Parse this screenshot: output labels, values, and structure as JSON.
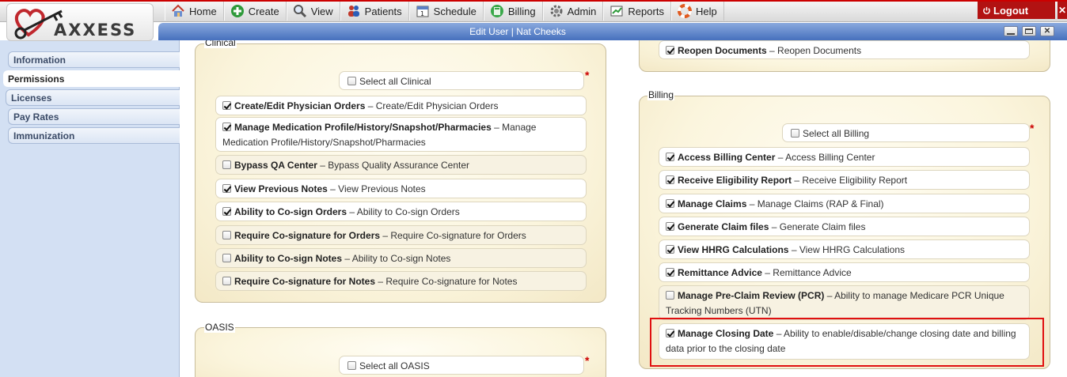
{
  "app": {
    "brand": "AXXESS",
    "window_title": "Edit User | Nat Cheeks",
    "logout_label": "Logout",
    "close_glyph": "✕"
  },
  "nav": [
    {
      "label": "Home",
      "icon": "house-icon"
    },
    {
      "label": "Create",
      "icon": "plus-icon"
    },
    {
      "label": "View",
      "icon": "magnifier-icon"
    },
    {
      "label": "Patients",
      "icon": "people-icon"
    },
    {
      "label": "Schedule",
      "icon": "calendar-icon"
    },
    {
      "label": "Billing",
      "icon": "calculator-icon"
    },
    {
      "label": "Admin",
      "icon": "gear-icon"
    },
    {
      "label": "Reports",
      "icon": "report-icon"
    },
    {
      "label": "Help",
      "icon": "lifebuoy-icon"
    }
  ],
  "sidebar": {
    "active": "Permissions",
    "items": [
      "Information",
      "Permissions",
      "Licenses",
      "Pay Rates",
      "Immunization"
    ]
  },
  "clinical": {
    "legend": "Clinical",
    "select_all": "Select all Clinical",
    "items": [
      {
        "name": "Create/Edit Physician Orders",
        "desc": "Create/Edit Physician Orders",
        "checked": true
      },
      {
        "name": "Manage Medication Profile/History/Snapshot/Pharmacies",
        "desc": "Manage Medication Profile/History/Snapshot/Pharmacies",
        "checked": true
      },
      {
        "name": "Bypass QA Center",
        "desc": "Bypass Quality Assurance Center",
        "checked": false
      },
      {
        "name": "View Previous Notes",
        "desc": "View Previous Notes",
        "checked": true
      },
      {
        "name": "Ability to Co-sign Orders",
        "desc": "Ability to Co-sign Orders",
        "checked": true
      },
      {
        "name": "Require Co-signature for Orders",
        "desc": "Require Co-signature for Orders",
        "checked": false
      },
      {
        "name": "Ability to Co-sign Notes",
        "desc": "Ability to Co-sign Notes",
        "checked": false
      },
      {
        "name": "Require Co-signature for Notes",
        "desc": "Require Co-signature for Notes",
        "checked": false
      }
    ]
  },
  "oasis": {
    "legend": "OASIS",
    "select_all": "Select all OASIS"
  },
  "reopen": {
    "name": "Reopen Documents",
    "desc": "Reopen Documents",
    "checked": true
  },
  "billing": {
    "legend": "Billing",
    "select_all": "Select all Billing",
    "items": [
      {
        "name": "Access Billing Center",
        "desc": "Access Billing Center",
        "checked": true
      },
      {
        "name": "Receive Eligibility Report",
        "desc": "Receive Eligibility Report",
        "checked": true
      },
      {
        "name": "Manage Claims",
        "desc": "Manage Claims (RAP & Final)",
        "checked": true
      },
      {
        "name": "Generate Claim files",
        "desc": "Generate Claim files",
        "checked": true
      },
      {
        "name": "View HHRG Calculations",
        "desc": "View HHRG Calculations",
        "checked": true
      },
      {
        "name": "Remittance Advice",
        "desc": "Remittance Advice",
        "checked": true
      },
      {
        "name": "Manage Pre-Claim Review (PCR)",
        "desc": "Ability to manage Medicare PCR Unique Tracking Numbers (UTN)",
        "checked": false
      },
      {
        "name": "Manage Closing Date",
        "desc": "Ability to enable/disable/change closing date and billing data prior to the closing date",
        "checked": true
      }
    ]
  },
  "separator": " – ",
  "required_mark": "*",
  "colors": {
    "accent_blue": "#4670bd",
    "logout_red": "#b21212",
    "highlight_red": "#e01010",
    "panel_cream": "#fbf5dd"
  }
}
